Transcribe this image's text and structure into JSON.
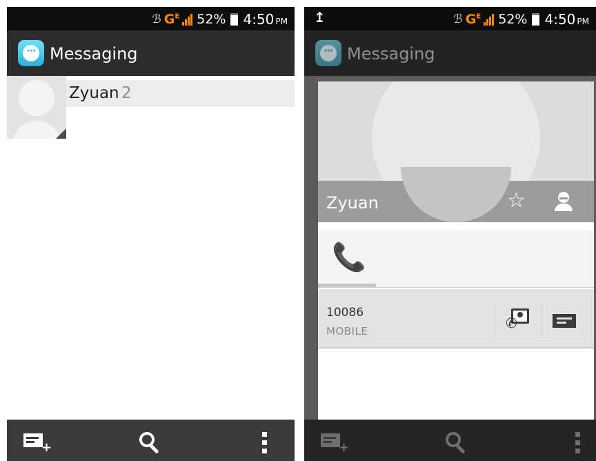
{
  "status_bar": {
    "network": "G",
    "network_sup": "E",
    "battery": "52%",
    "time": "4:50",
    "ampm": "PM",
    "upload_icon": "upload-icon"
  },
  "app": {
    "title": "Messaging",
    "icon": "messaging-app-icon"
  },
  "conversation_list": [
    {
      "name": "Zyuan",
      "count": "2"
    }
  ],
  "contact_card": {
    "name": "Zyuan",
    "phone_number": "10086",
    "phone_type": "MOBILE",
    "icons": [
      "star-icon",
      "person-icon",
      "phone-icon",
      "contact-call-icon",
      "sms-icon"
    ]
  },
  "bottom_bar": {
    "icons": [
      "compose-icon",
      "search-icon",
      "overflow-menu-icon"
    ]
  },
  "colors": {
    "accent_phone": "#1e9ad6",
    "network_orange": "#ff8a00",
    "actionbar": "#2c2c2c",
    "bottombar": "#3a3a3a"
  }
}
